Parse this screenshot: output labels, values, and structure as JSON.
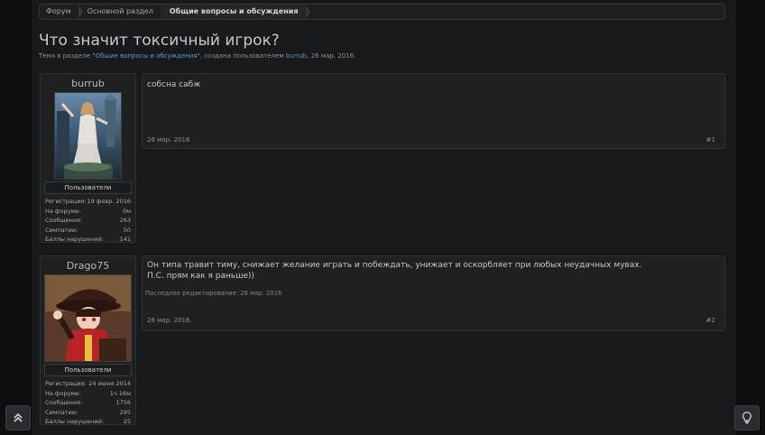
{
  "breadcrumb": {
    "items": [
      "Форум",
      "Основной раздел",
      "Общие вопросы и обсуждения"
    ]
  },
  "thread": {
    "title": "Что значит токсичный игрок?",
    "meta_prefix": "Тема в разделе \"",
    "meta_section": "Общие вопросы и обсуждения",
    "meta_middle": "\", создана пользователем ",
    "meta_author": "burrub",
    "meta_date": ", 26 мар. 2016."
  },
  "posts": [
    {
      "user": {
        "name": "burrub",
        "group": "Пользователи",
        "stats": [
          {
            "label": "Регистрация:",
            "value": "19 февр. 2016"
          },
          {
            "label": "На форуме:",
            "value": "0м"
          },
          {
            "label": "Сообщения:",
            "value": "263"
          },
          {
            "label": "Симпатии:",
            "value": "50"
          },
          {
            "label": "Баллы нарушений:",
            "value": "141"
          }
        ]
      },
      "text_lines": [
        "собсна сабж"
      ],
      "edit_note": "",
      "date": "26 мар. 2016",
      "number": "#1"
    },
    {
      "user": {
        "name": "Drago75",
        "group": "Пользователи",
        "stats": [
          {
            "label": "Регистрация:",
            "value": "24 июня 2014"
          },
          {
            "label": "На форуме:",
            "value": "1ч 16м"
          },
          {
            "label": "Сообщения:",
            "value": "1756"
          },
          {
            "label": "Симпатии:",
            "value": "295"
          },
          {
            "label": "Баллы нарушений:",
            "value": "25"
          }
        ]
      },
      "text_lines": [
        "Он типа травит тиму, снижает желание играть и побеждать, унижает и оскорбляет при любых неудачных мувах.",
        "П.С. прям как я раньше))"
      ],
      "edit_note": "Последнее редактирование: 26 мар. 2016",
      "date": "26 мар. 2016.",
      "number": "#2"
    }
  ],
  "controls": {
    "scroll_top_icon": "double-chevron-up-icon",
    "lightbulb_icon": "lightbulb-icon"
  }
}
